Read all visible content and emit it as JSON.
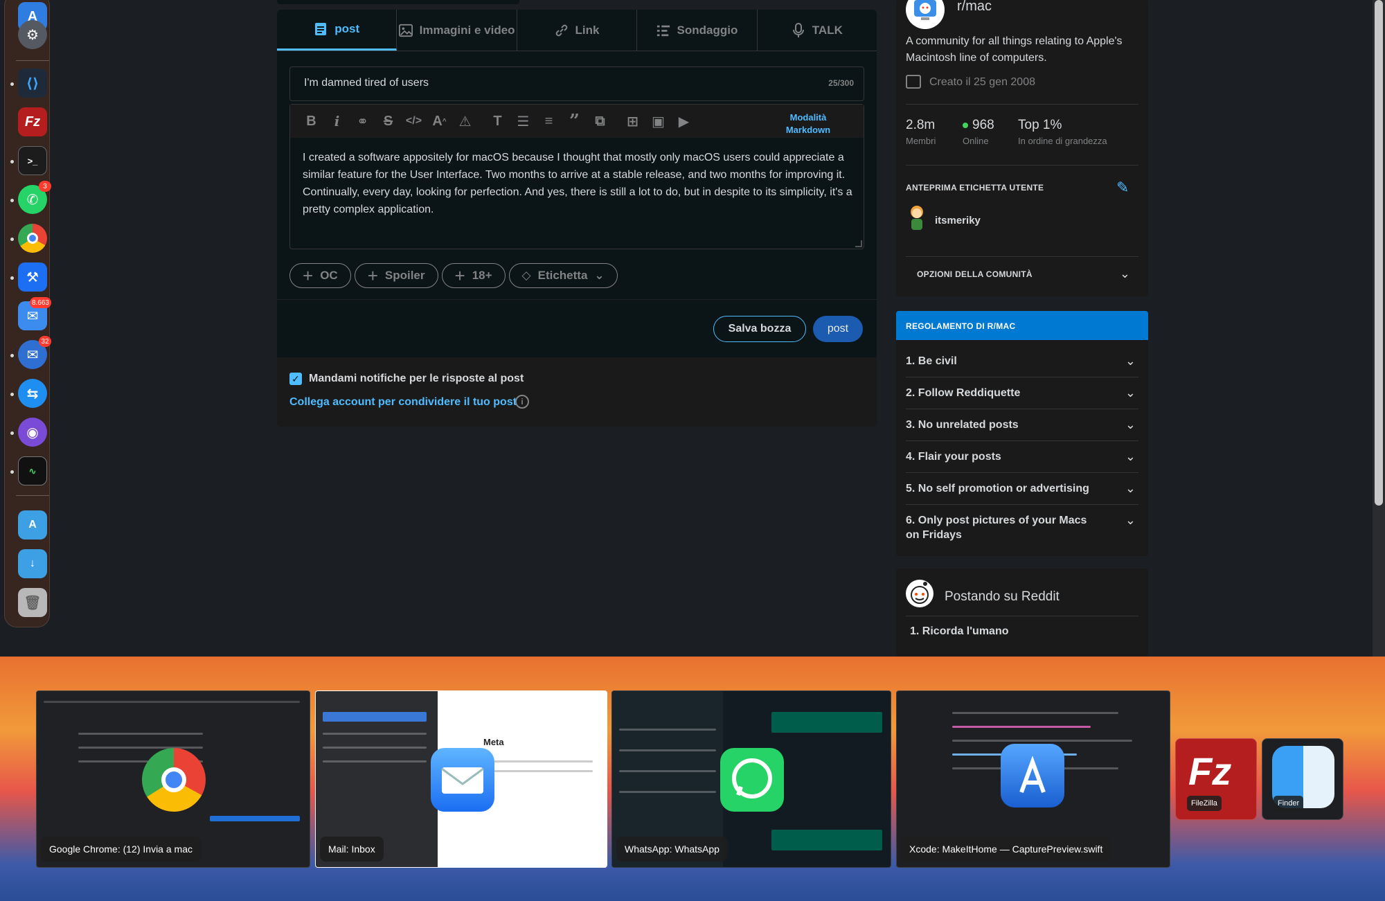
{
  "composer": {
    "tabs": [
      {
        "label": "post",
        "icon": "document-icon"
      },
      {
        "label": "Immagini e video",
        "icon": "image-icon"
      },
      {
        "label": "Link",
        "icon": "link-icon"
      },
      {
        "label": "Sondaggio",
        "icon": "poll-icon"
      },
      {
        "label": "TALK",
        "icon": "microphone-icon"
      }
    ],
    "title_value": "I'm damned tired of users",
    "title_counter": "25/300",
    "markdown_mode": "Modalità Markdown",
    "body": "I created a software appositely for macOS because I thought that mostly only macOS users could appreciate a similar feature for the User Interface. Two months to arrive at a stable release, and two months for improving it. Continually, every day, looking for perfection. And yes, there is still a lot to do, but in despite to its simplicity, it's a pretty complex application.",
    "flairs": [
      "OC",
      "Spoiler",
      "18+",
      "Etichetta"
    ],
    "save_draft": "Salva bozza",
    "post_button": "post",
    "notify_label": "Mandami notifiche per le risposte al post",
    "notify_checked": true,
    "connect_link": "Collega account per condividere il tuo post"
  },
  "community": {
    "name": "r/mac",
    "description": "A community for all things relating to Apple's Macintosh line of computers.",
    "created": "Creato il 25 gen 2008",
    "stats": [
      {
        "value": "2.8m",
        "label": "Membri"
      },
      {
        "value": "968",
        "label": "Online"
      },
      {
        "value": "Top 1%",
        "label": "In ordine di grandezza"
      }
    ],
    "user_flair_heading": "ANTEPRIMA ETICHETTA UTENTE",
    "username": "itsmeriky",
    "options_label": "OPZIONI DELLA COMUNITÀ"
  },
  "rules": {
    "title": "REGOLAMENTO DI R/MAC",
    "items": [
      "1. Be civil",
      "2. Follow Reddiquette",
      "3. No unrelated posts",
      "4. Flair your posts",
      "5. No self promotion or advertising",
      "6. Only post pictures of your Macs on Fridays"
    ]
  },
  "posting": {
    "title": "Postando su Reddit",
    "first_rule": "1. Ricorda l'umano"
  },
  "dock": {
    "badges": {
      "whatsapp": "3",
      "mail": "8.663",
      "thunderbird": "32"
    }
  },
  "switcher": {
    "windows": [
      {
        "label": "Google Chrome: (12) Invia a mac",
        "app": "chrome-icon"
      },
      {
        "label": "Mail: Inbox",
        "app": "mail-icon"
      },
      {
        "label": "WhatsApp: WhatsApp",
        "app": "whatsapp-icon"
      },
      {
        "label": "Xcode: MakeItHome — CapturePreview.swift",
        "app": "xcode-icon"
      }
    ],
    "apps": [
      {
        "label": "FileZilla",
        "app": "filezilla-icon"
      },
      {
        "label": "Finder",
        "app": "finder-icon"
      }
    ],
    "meta_logo": "Meta"
  },
  "colors": {
    "accent": "#4fbcff",
    "rules_header": "#0079d3",
    "panel": "#1a1a1b",
    "online": "#46d160"
  }
}
